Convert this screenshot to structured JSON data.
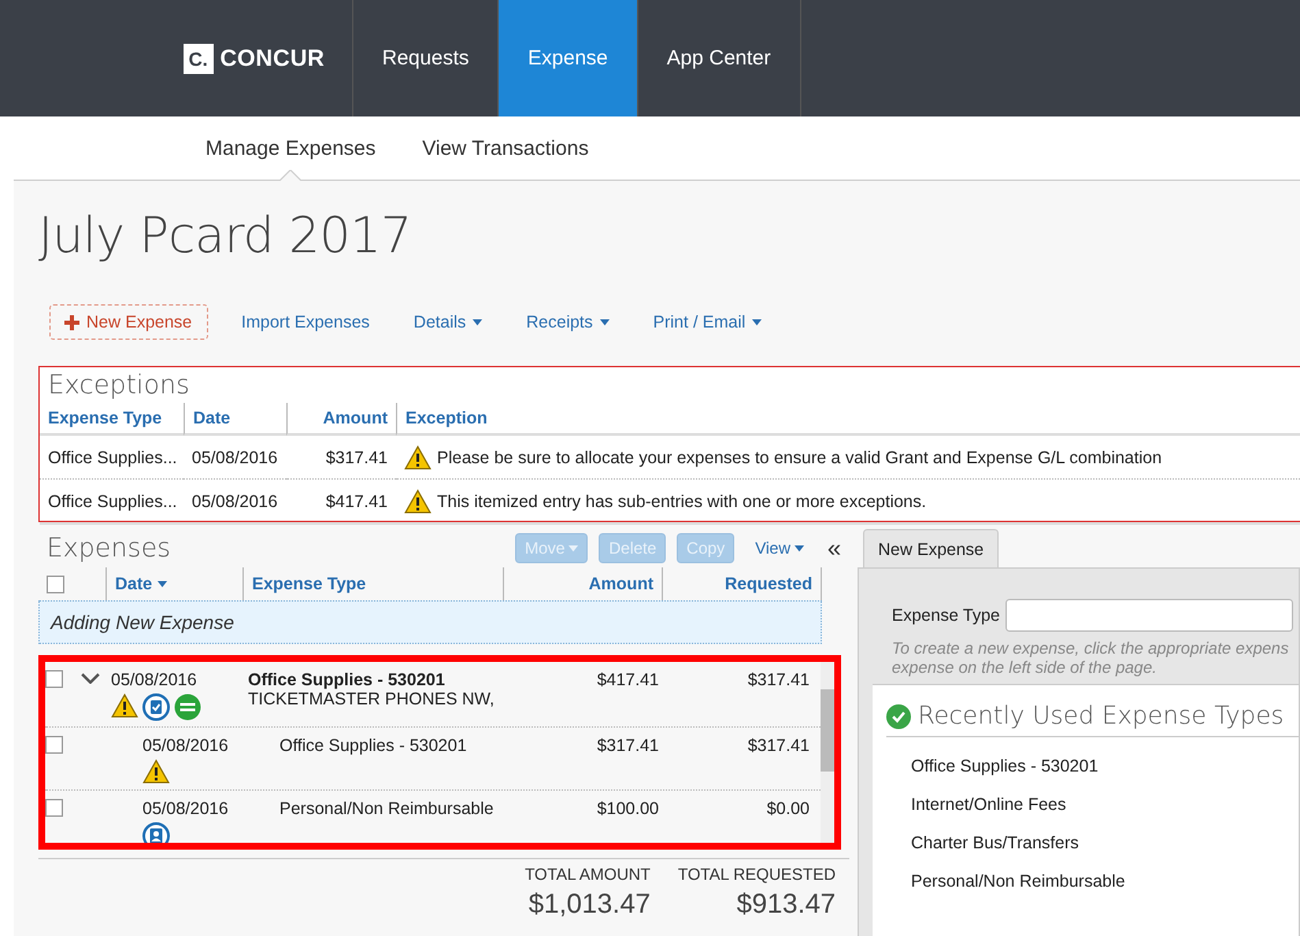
{
  "header": {
    "logo_letter": "C.",
    "logo_text": "CONCUR",
    "nav": [
      {
        "label": "Requests",
        "selected": false
      },
      {
        "label": "Expense",
        "selected": true
      },
      {
        "label": "App Center",
        "selected": false
      }
    ]
  },
  "subnav": [
    {
      "label": "Manage Expenses",
      "selected": true
    },
    {
      "label": "View Transactions",
      "selected": false
    }
  ],
  "title": "July Pcard 2017",
  "toolbar": {
    "new_expense": "New Expense",
    "links": [
      {
        "label": "Import Expenses",
        "has_menu": false
      },
      {
        "label": "Details",
        "has_menu": true
      },
      {
        "label": "Receipts",
        "has_menu": true
      },
      {
        "label": "Print / Email",
        "has_menu": true
      }
    ]
  },
  "exceptions": {
    "title": "Exceptions",
    "columns": [
      "Expense Type",
      "Date",
      "Amount",
      "Exception"
    ],
    "rows": [
      {
        "expense_type": "Office Supplies...",
        "date": "05/08/2016",
        "amount": "$317.41",
        "exception": "Please be sure to allocate your expenses to ensure a valid Grant and Expense G/L combination"
      },
      {
        "expense_type": "Office Supplies...",
        "date": "05/08/2016",
        "amount": "$417.41",
        "exception": "This itemized entry has sub-entries with one or more exceptions."
      }
    ]
  },
  "expenses": {
    "title": "Expenses",
    "actions": [
      {
        "label": "Move",
        "disabled": true,
        "has_menu": true
      },
      {
        "label": "Delete",
        "disabled": true,
        "has_menu": false
      },
      {
        "label": "Copy",
        "disabled": true,
        "has_menu": false
      },
      {
        "label": "View",
        "disabled": false,
        "has_menu": true
      }
    ],
    "collapse": "«",
    "select_all_checked": false,
    "columns": [
      {
        "label": "Date",
        "sorted": true
      },
      {
        "label": "Expense Type",
        "sorted": false
      },
      {
        "label": "Amount",
        "sorted": false
      },
      {
        "label": "Requested",
        "sorted": false
      }
    ],
    "adding_row": "Adding New Expense",
    "rows": [
      {
        "kind": "parent",
        "checked": false,
        "expanded": true,
        "date": "05/08/2016",
        "expense_type": "Office Supplies - 530201",
        "vendor": "TICKETMASTER PHONES NW,",
        "amount": "$417.41",
        "requested": "$317.41",
        "has_exception": true,
        "has_receipt": true,
        "itemized": true,
        "personal": false
      },
      {
        "kind": "child",
        "checked": false,
        "date": "05/08/2016",
        "expense_type": "Office Supplies - 530201",
        "amount": "$317.41",
        "requested": "$317.41",
        "has_exception": true,
        "has_receipt": false,
        "itemized": false,
        "personal": false
      },
      {
        "kind": "child",
        "checked": false,
        "date": "05/08/2016",
        "expense_type": "Personal/Non Reimbursable",
        "amount": "$100.00",
        "requested": "$0.00",
        "has_exception": false,
        "has_receipt": false,
        "itemized": false,
        "personal": true
      }
    ],
    "totals": [
      {
        "label": "TOTAL AMOUNT",
        "value": "$1,013.47"
      },
      {
        "label": "TOTAL REQUESTED",
        "value": "$913.47"
      }
    ]
  },
  "new_expense_panel": {
    "tab": "New Expense",
    "field_label": "Expense Type",
    "hint": "To create a new expense, click the appropriate expens\nexpense on the left side of the page.",
    "recent_title": "Recently Used Expense Types",
    "recent_items": [
      "Office Supplies - 530201",
      "Internet/Online Fees",
      "Charter Bus/Transfers",
      "Personal/Non Reimbursable"
    ]
  }
}
